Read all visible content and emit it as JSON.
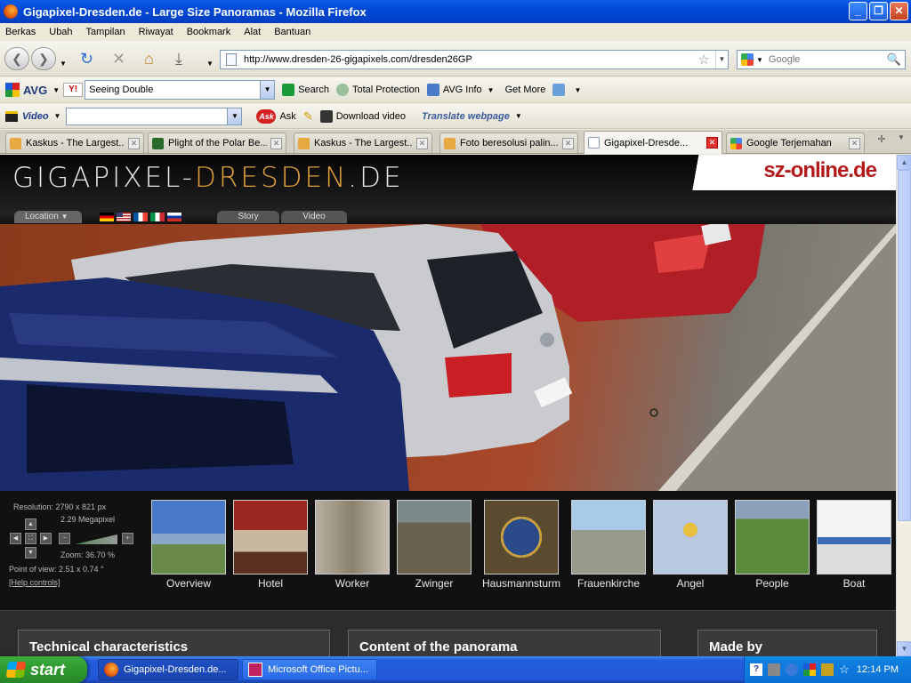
{
  "window": {
    "title": "Gigapixel-Dresden.de - Large Size Panoramas - Mozilla Firefox"
  },
  "menu": [
    "Berkas",
    "Ubah",
    "Tampilan",
    "Riwayat",
    "Bookmark",
    "Alat",
    "Bantuan"
  ],
  "nav": {
    "url": "http://www.dresden-26-gigapixels.com/dresden26GP",
    "search_placeholder": "Google"
  },
  "avg_toolbar": {
    "logo": "AVG",
    "search_value": "Seeing Double",
    "search_label": "Search",
    "total_protection": "Total Protection",
    "avg_info": "AVG Info",
    "get_more": "Get More"
  },
  "video_toolbar": {
    "video_label": "Video",
    "ask_logo": "Ask",
    "ask_label": "Ask",
    "download_video": "Download video",
    "translate": "Translate webpage"
  },
  "tabs": [
    {
      "label": "Kaskus - The Largest..."
    },
    {
      "label": "Plight of the Polar Be..."
    },
    {
      "label": "Kaskus - The Largest..."
    },
    {
      "label": "Foto beresolusi palin..."
    },
    {
      "label": "Gigapixel-Dresde..."
    },
    {
      "label": "Google Terjemahan"
    }
  ],
  "site": {
    "brand_white": "GIGAPIXEL-",
    "brand_orange": "DRESDEN",
    "brand_tail": ".DE",
    "sz": "sz-online.de",
    "location": "Location",
    "story": "Story",
    "video": "Video"
  },
  "info": {
    "resolution": "Resolution: 2790 x 821 px",
    "megapixel": "2.29 Megapixel",
    "zoom": "Zoom: 36.70 %",
    "pov": "Point of view: 2.51 x 0.74 °",
    "help": "[Help controls]"
  },
  "thumbnails": [
    "Overview",
    "Hotel",
    "Worker",
    "Zwinger",
    "Hausmannsturm",
    "Frauenkirche",
    "Angel",
    "People",
    "Boat"
  ],
  "sections": [
    "Technical characteristics",
    "Content of the panorama",
    "Made by"
  ],
  "taskbar": {
    "start": "start",
    "tasks": [
      "Gigapixel-Dresden.de...",
      "Microsoft Office Pictu..."
    ],
    "clock": "12:14 PM"
  }
}
